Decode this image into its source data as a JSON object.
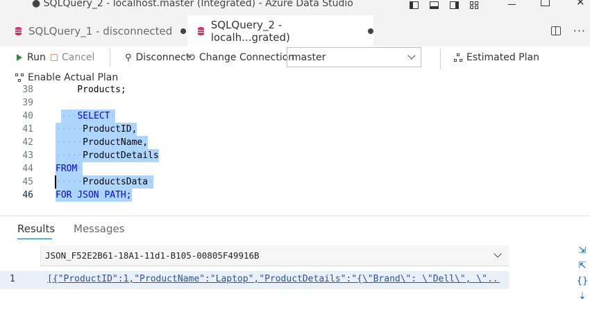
{
  "window": {
    "title": "● SQLQuery_2 - localhost.master (Integrated) - Azure Data Studio"
  },
  "tabs": [
    {
      "label": "SQLQuery_1 - disconnected",
      "active": false
    },
    {
      "label": "SQLQuery_2 - localh...grated)",
      "active": true
    }
  ],
  "toolbar": {
    "run": "Run",
    "cancel": "Cancel",
    "disconnect": "Disconnect",
    "change_connection": "Change Connection",
    "database": "master",
    "estimated_plan": "Estimated Plan",
    "enable_actual_plan": "Enable Actual Plan"
  },
  "editor": {
    "lines": [
      {
        "num": "38",
        "text": "    Products;"
      },
      {
        "num": "39",
        "text": ""
      },
      {
        "num": "40",
        "text": "SELECT"
      },
      {
        "num": "41",
        "text": "ProductID,"
      },
      {
        "num": "42",
        "text": "ProductName,"
      },
      {
        "num": "43",
        "text": "ProductDetails"
      },
      {
        "num": "44",
        "text": "FROM"
      },
      {
        "num": "45",
        "text": "ProductsData"
      },
      {
        "num": "46",
        "text": "FOR JSON PATH;"
      }
    ]
  },
  "results": {
    "tabs": [
      "Results",
      "Messages"
    ],
    "column": "JSON_F52E2B61-18A1-11d1-B105-00805F49916B",
    "rows": [
      {
        "num": "1",
        "value": "[{\"ProductID\":1,\"ProductName\":\"Laptop\",\"ProductDetails\":\"{\\\"Brand\\\": \\\"Dell\\\", \\\"..."
      }
    ]
  },
  "colors": {
    "keyword": "#0000ff",
    "selection": "#add6ff",
    "accent": "#005fb8",
    "run_icon": "#388a34"
  },
  "icons": [
    "layout-icon",
    "database-icon",
    "split-editor-icon",
    "more-icon",
    "run-icon",
    "cancel-icon",
    "disconnect-icon",
    "change-connection-icon",
    "estimated-plan-icon",
    "actual-plan-icon",
    "save-csv-icon",
    "save-excel-icon",
    "save-json-icon",
    "save-xml-icon"
  ]
}
